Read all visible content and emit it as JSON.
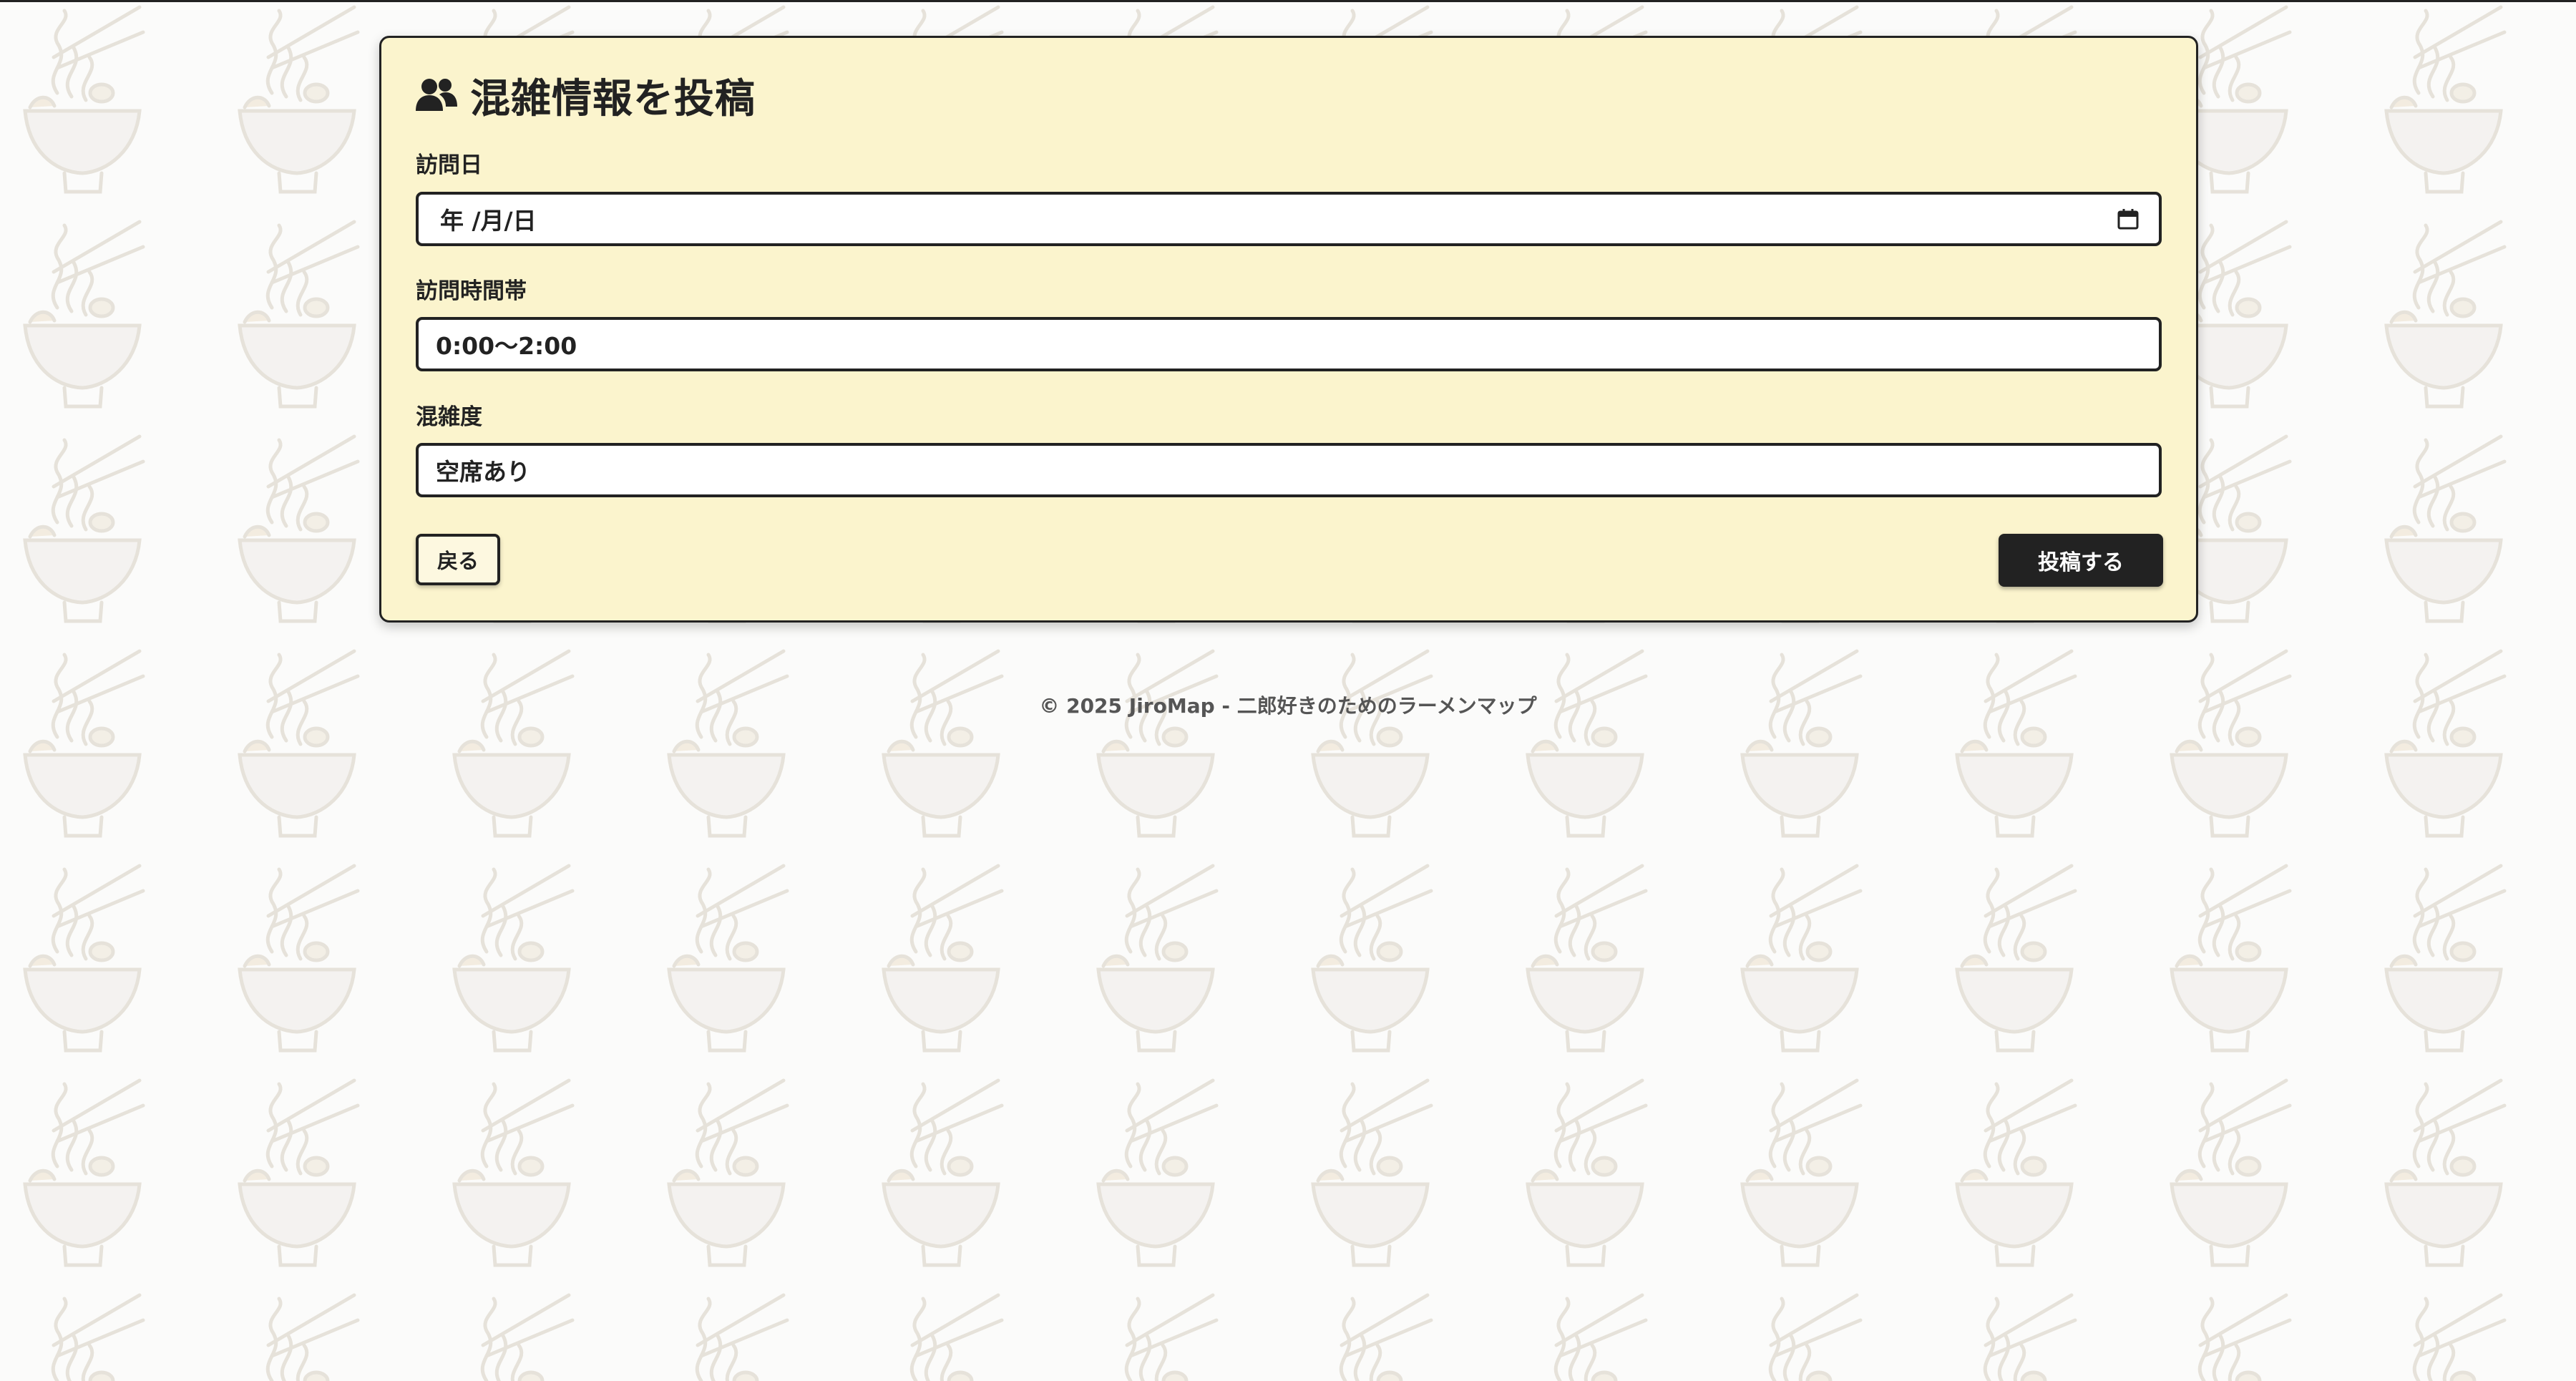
{
  "form": {
    "title": "混雑情報を投稿",
    "title_icon": "users-icon",
    "date_label": "訪問日",
    "date_value": "年 /月/日",
    "time_label": "訪問時間帯",
    "time_value": "0:00〜2:00",
    "crowd_label": "混雑度",
    "crowd_value": "空席あり",
    "back_label": "戻る",
    "submit_label": "投稿する"
  },
  "footer": {
    "text": "© 2025 JiroMap - 二郎好きのためのラーメンマップ"
  },
  "colors": {
    "card_background": "#fbf4cd",
    "border": "#222222",
    "primary_button": "#222222",
    "page_background": "#fbfbfa"
  }
}
